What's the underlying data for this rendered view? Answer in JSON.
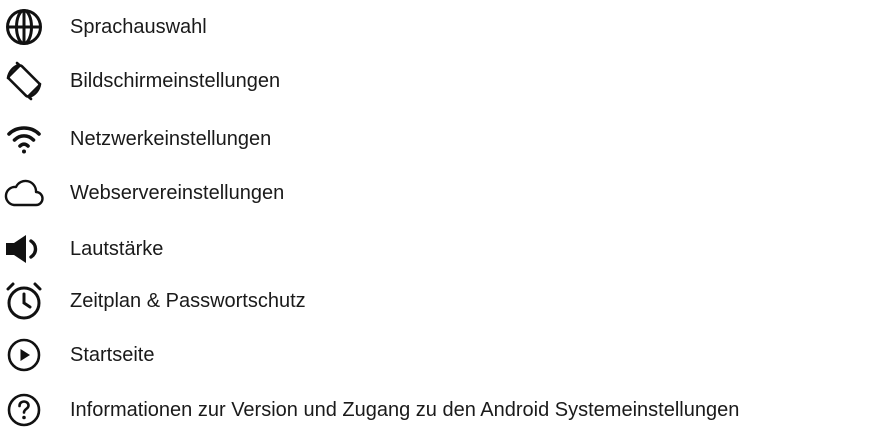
{
  "menu": {
    "items": [
      {
        "id": "language",
        "icon": "globe-icon",
        "label": "Sprachauswahl"
      },
      {
        "id": "screen",
        "icon": "screen-rotation-icon",
        "label": "Bildschirmeinstellungen"
      },
      {
        "id": "network",
        "icon": "wifi-icon",
        "label": "Netzwerkeinstellungen"
      },
      {
        "id": "webserver",
        "icon": "cloud-icon",
        "label": "Webservereinstellungen"
      },
      {
        "id": "volume",
        "icon": "speaker-icon",
        "label": "Lautstärke"
      },
      {
        "id": "schedule",
        "icon": "alarm-clock-icon",
        "label": "Zeitplan & Passwortschutz"
      },
      {
        "id": "home",
        "icon": "play-circle-icon",
        "label": "Startseite"
      },
      {
        "id": "info",
        "icon": "help-circle-icon",
        "label": "Informationen zur Version und Zugang zu den Android Systemeinstellungen"
      }
    ]
  }
}
